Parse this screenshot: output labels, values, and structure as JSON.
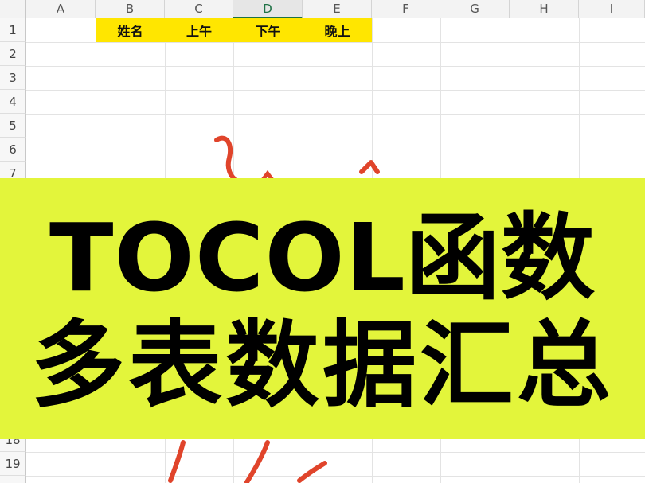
{
  "spreadsheet": {
    "columns": [
      "A",
      "B",
      "C",
      "D",
      "E",
      "F",
      "G",
      "H",
      "I"
    ],
    "active_column": "D",
    "rows_visible_top": [
      "1",
      "2",
      "3",
      "4",
      "5",
      "6",
      "7"
    ],
    "rows_visible_bottom": [
      "18",
      "19"
    ],
    "header_cells": [
      "姓名",
      "上午",
      "下午",
      "晚上"
    ],
    "header_fill_color": "#ffe600"
  },
  "banner": {
    "line1": "TOCOL函数",
    "line2": "多表数据汇总",
    "background_color": "#e3f53b"
  },
  "annotation_color": "#e0442b"
}
